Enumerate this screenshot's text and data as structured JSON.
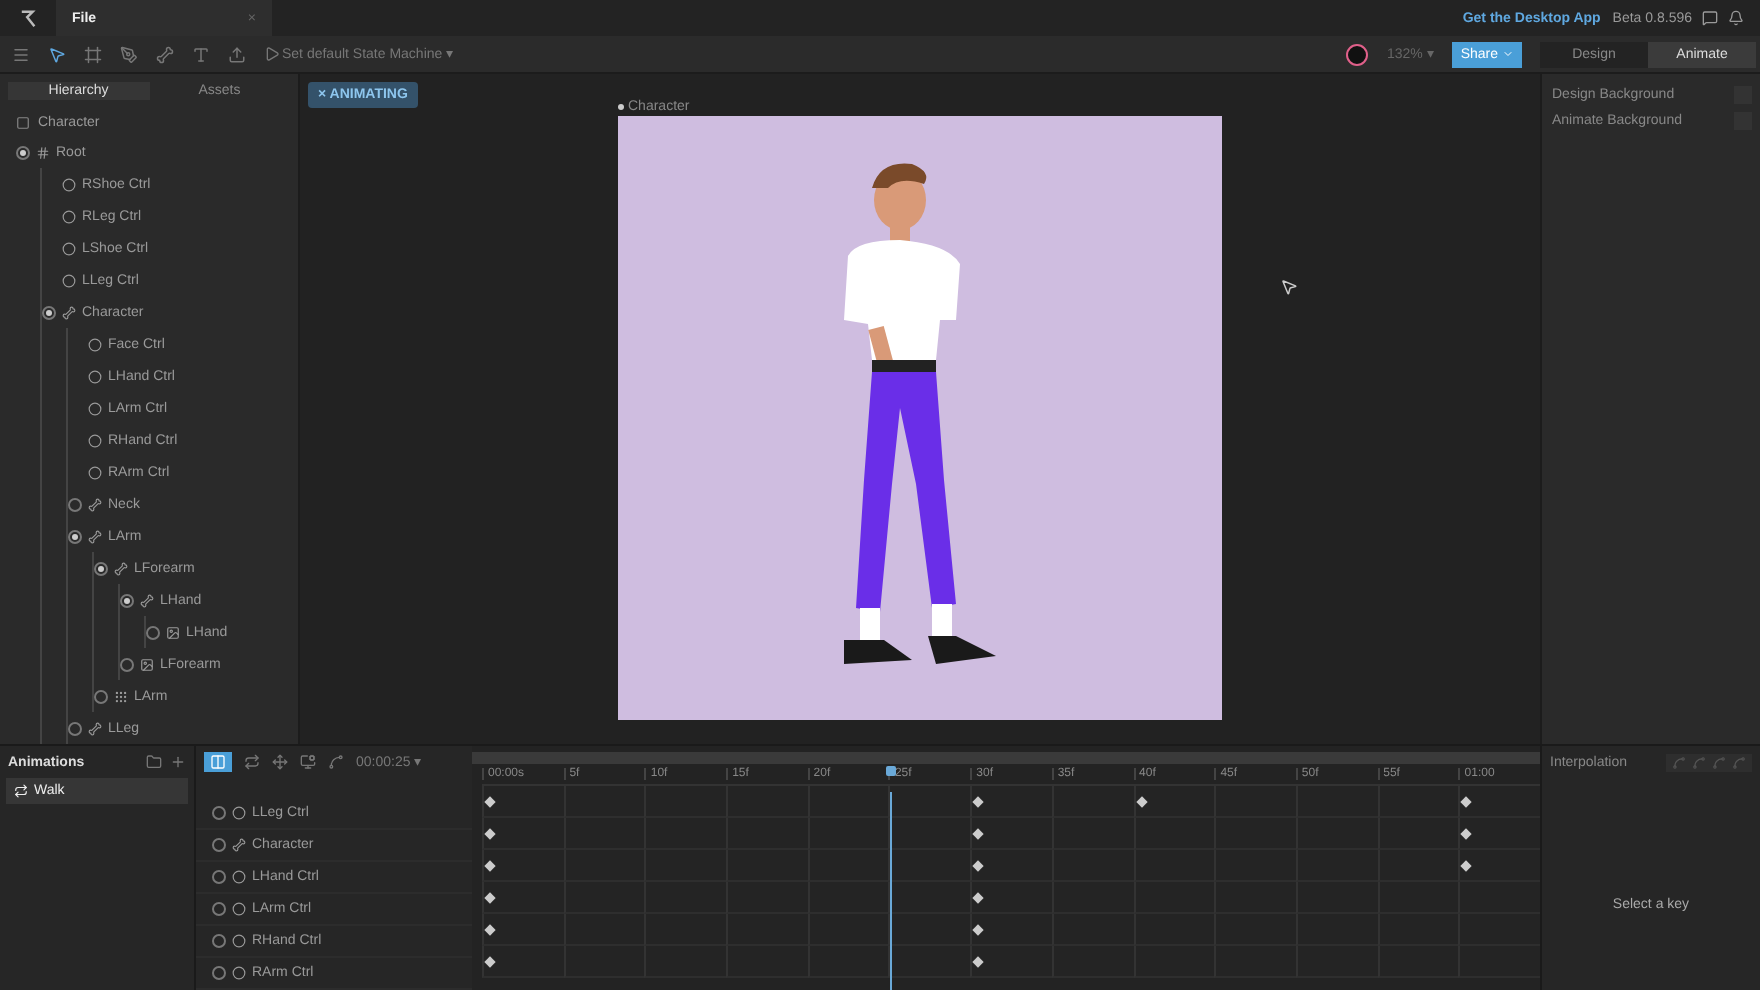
{
  "titlebar": {
    "tab": "File",
    "close": "×",
    "desktop_link": "Get the Desktop App",
    "version": "Beta 0.8.596"
  },
  "toolbar": {
    "state_machine": "Set default State Machine",
    "state_caret": "▾",
    "zoom": "132%",
    "zoom_caret": "▾",
    "share": "Share",
    "modes": [
      {
        "label": "Design",
        "selected": false
      },
      {
        "label": "Animate",
        "selected": true
      }
    ]
  },
  "left_panel": {
    "tabs": [
      {
        "label": "Hierarchy",
        "selected": true
      },
      {
        "label": "Assets",
        "selected": false
      }
    ],
    "artboard": "Character",
    "tree": [
      {
        "name": "Root",
        "kind": "root",
        "expanded": true,
        "children": [
          {
            "name": "RShoe Ctrl",
            "kind": "ctrl"
          },
          {
            "name": "RLeg Ctrl",
            "kind": "ctrl"
          },
          {
            "name": "LShoe Ctrl",
            "kind": "ctrl"
          },
          {
            "name": "LLeg Ctrl",
            "kind": "ctrl"
          },
          {
            "name": "Character",
            "kind": "bone",
            "expanded": true,
            "children": [
              {
                "name": "Face Ctrl",
                "kind": "ctrl"
              },
              {
                "name": "LHand Ctrl",
                "kind": "ctrl"
              },
              {
                "name": "LArm Ctrl",
                "kind": "ctrl"
              },
              {
                "name": "RHand Ctrl",
                "kind": "ctrl"
              },
              {
                "name": "RArm Ctrl",
                "kind": "ctrl"
              },
              {
                "name": "Neck",
                "kind": "bone",
                "expanded": false
              },
              {
                "name": "LArm",
                "kind": "bone",
                "expanded": true,
                "children": [
                  {
                    "name": "LForearm",
                    "kind": "bone",
                    "expanded": true,
                    "children": [
                      {
                        "name": "LHand",
                        "kind": "bone",
                        "expanded": true,
                        "children": [
                          {
                            "name": "LHand",
                            "kind": "image",
                            "expanded": false
                          }
                        ]
                      },
                      {
                        "name": "LForearm",
                        "kind": "image",
                        "expanded": false
                      }
                    ]
                  },
                  {
                    "name": "LArm",
                    "kind": "group",
                    "expanded": false
                  }
                ]
              },
              {
                "name": "LLeg",
                "kind": "bone",
                "expanded": false
              }
            ]
          }
        ]
      }
    ]
  },
  "canvas": {
    "badge_close": "×",
    "mode_badge": "ANIMATING",
    "artboard_label": "Character"
  },
  "right_panel": {
    "settings": [
      {
        "label": "Design Background"
      },
      {
        "label": "Animate Background"
      }
    ]
  },
  "animations": {
    "title": "Animations",
    "items": [
      {
        "name": "Walk",
        "selected": true
      }
    ]
  },
  "timeline": {
    "time": "00:00:25",
    "time_caret": "▾",
    "playhead": {
      "level": 0.417
    },
    "ticks": [
      "00:00s",
      "5f",
      "10f",
      "15f",
      "20f",
      "25f",
      "30f",
      "35f",
      "40f",
      "45f",
      "50f",
      "55f",
      "01:00"
    ],
    "tracks": [
      {
        "name": "LLeg Ctrl",
        "kind": "ctrl",
        "keys": [
          true,
          false,
          false,
          false,
          false,
          false,
          true,
          false,
          true,
          false,
          false,
          false,
          true
        ]
      },
      {
        "name": "Character",
        "kind": "bone",
        "keys": [
          true,
          false,
          false,
          false,
          false,
          false,
          true,
          false,
          false,
          false,
          false,
          false,
          true
        ]
      },
      {
        "name": "LHand Ctrl",
        "kind": "ctrl",
        "keys": [
          true,
          false,
          false,
          false,
          false,
          false,
          true,
          false,
          false,
          false,
          false,
          false,
          true
        ]
      },
      {
        "name": "LArm Ctrl",
        "kind": "ctrl",
        "keys": [
          true,
          false,
          false,
          false,
          false,
          false,
          true,
          false,
          false,
          false,
          false,
          false,
          false
        ]
      },
      {
        "name": "RHand Ctrl",
        "kind": "ctrl",
        "keys": [
          true,
          false,
          false,
          false,
          false,
          false,
          true,
          false,
          false,
          false,
          false,
          false,
          false
        ]
      },
      {
        "name": "RArm Ctrl",
        "kind": "ctrl",
        "keys": [
          true,
          false,
          false,
          false,
          false,
          false,
          true,
          false,
          false,
          false,
          false,
          false,
          false
        ]
      }
    ]
  },
  "interpolation": {
    "title": "Interpolation",
    "empty": "Select a key"
  }
}
